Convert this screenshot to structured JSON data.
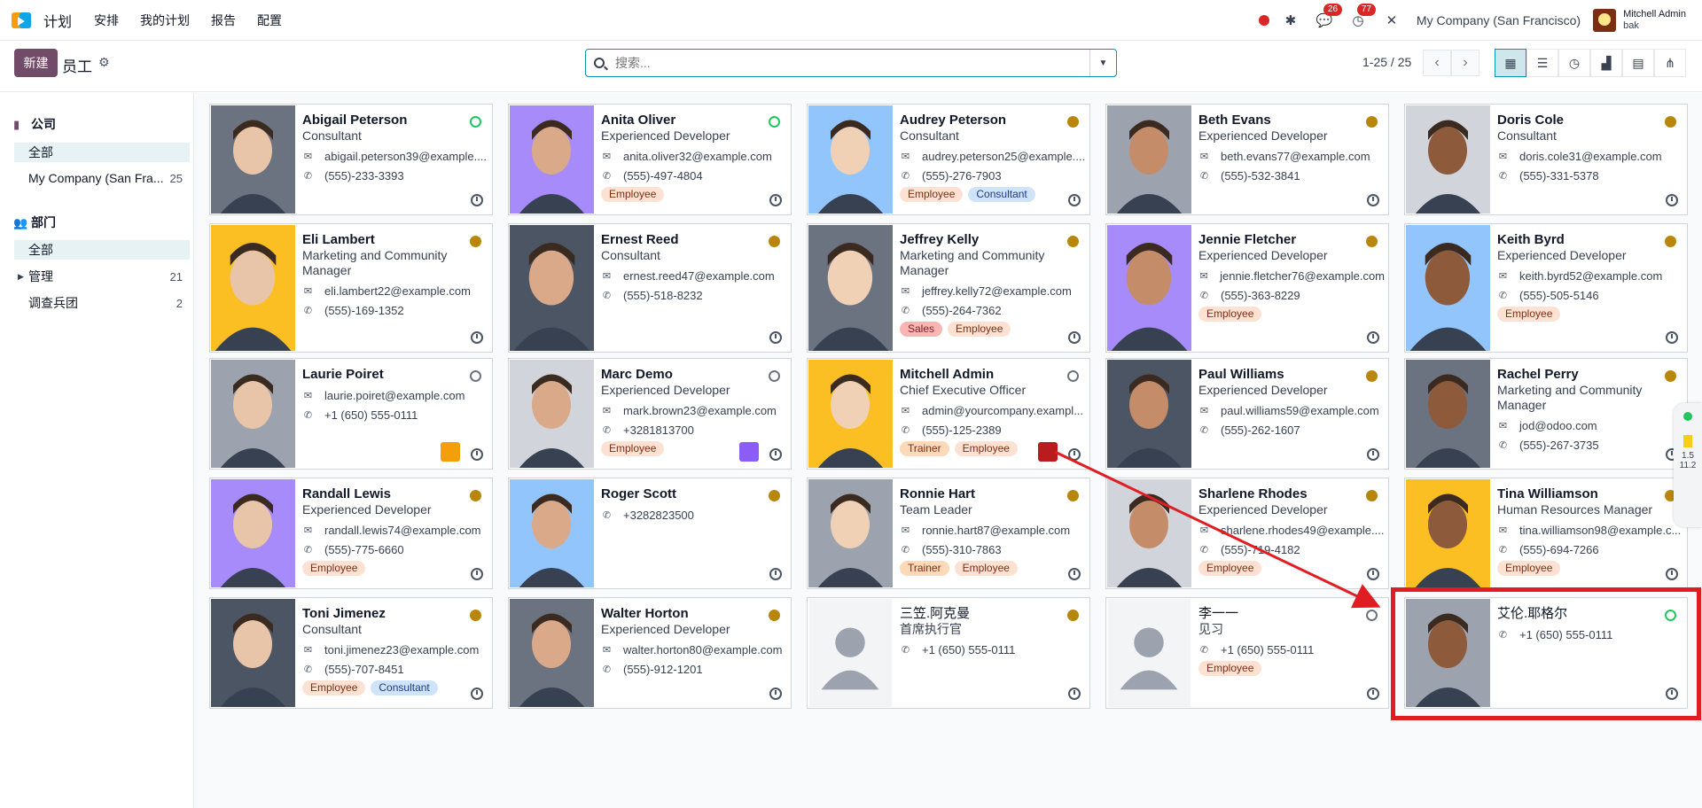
{
  "app": {
    "name": "计划",
    "menu": [
      "安排",
      "我的计划",
      "报告",
      "配置"
    ]
  },
  "nav": {
    "messages_badge": "26",
    "activities_badge": "77",
    "company": "My Company (San Francisco)",
    "user": "Mitchell Admin",
    "db": "bak"
  },
  "control": {
    "new_label": "新建",
    "title": "员工",
    "search_placeholder": "搜索...",
    "pager": "1-25 / 25"
  },
  "sidebar": {
    "company_header": "公司",
    "company_items": [
      {
        "label": "全部",
        "count": ""
      },
      {
        "label": "My Company (San Fra...",
        "count": "25"
      }
    ],
    "dept_header": "部门",
    "dept_items": [
      {
        "label": "全部",
        "count": ""
      },
      {
        "label": "管理",
        "count": "21"
      },
      {
        "label": "调查兵团",
        "count": "2"
      }
    ]
  },
  "cards": [
    {
      "name": "Abigail Peterson",
      "job": "Consultant",
      "email": "abigail.peterson39@example....",
      "phone": "(555)-233-3393",
      "tags": [],
      "status": "online"
    },
    {
      "name": "Anita Oliver",
      "job": "Experienced Developer",
      "email": "anita.oliver32@example.com",
      "phone": "(555)-497-4804",
      "tags": [
        "Employee"
      ],
      "status": "online"
    },
    {
      "name": "Audrey Peterson",
      "job": "Consultant",
      "email": "audrey.peterson25@example....",
      "phone": "(555)-276-7903",
      "tags": [
        "Employee",
        "Consultant"
      ],
      "status": "away"
    },
    {
      "name": "Beth Evans",
      "job": "Experienced Developer",
      "email": "beth.evans77@example.com",
      "phone": "(555)-532-3841",
      "tags": [],
      "status": "away"
    },
    {
      "name": "Doris Cole",
      "job": "Consultant",
      "email": "doris.cole31@example.com",
      "phone": "(555)-331-5378",
      "tags": [],
      "status": "away"
    },
    {
      "name": "Eli Lambert",
      "job": "Marketing and Community Manager",
      "email": "eli.lambert22@example.com",
      "phone": "(555)-169-1352",
      "tags": [],
      "status": "away"
    },
    {
      "name": "Ernest Reed",
      "job": "Consultant",
      "email": "ernest.reed47@example.com",
      "phone": "(555)-518-8232",
      "tags": [],
      "status": "away"
    },
    {
      "name": "Jeffrey Kelly",
      "job": "Marketing and Community Manager",
      "email": "jeffrey.kelly72@example.com",
      "phone": "(555)-264-7362",
      "tags": [
        "Sales",
        "Employee"
      ],
      "status": "away"
    },
    {
      "name": "Jennie Fletcher",
      "job": "Experienced Developer",
      "email": "jennie.fletcher76@example.com",
      "phone": "(555)-363-8229",
      "tags": [
        "Employee"
      ],
      "status": "away"
    },
    {
      "name": "Keith Byrd",
      "job": "Experienced Developer",
      "email": "keith.byrd52@example.com",
      "phone": "(555)-505-5146",
      "tags": [
        "Employee"
      ],
      "status": "away"
    },
    {
      "name": "Laurie Poiret",
      "job": "",
      "email": "laurie.poiret@example.com",
      "phone": "+1 (650) 555-0111",
      "tags": [],
      "status": "off"
    },
    {
      "name": "Marc Demo",
      "job": "Experienced Developer",
      "email": "mark.brown23@example.com",
      "phone": "+3281813700",
      "tags": [
        "Employee"
      ],
      "status": "off"
    },
    {
      "name": "Mitchell Admin",
      "job": "Chief Executive Officer",
      "email": "admin@yourcompany.exampl...",
      "phone": "(555)-125-2389",
      "tags": [
        "Trainer",
        "Employee"
      ],
      "status": "off"
    },
    {
      "name": "Paul Williams",
      "job": "Experienced Developer",
      "email": "paul.williams59@example.com",
      "phone": "(555)-262-1607",
      "tags": [],
      "status": "away"
    },
    {
      "name": "Rachel Perry",
      "job": "Marketing and Community Manager",
      "email": "jod@odoo.com",
      "phone": "(555)-267-3735",
      "tags": [],
      "status": "away"
    },
    {
      "name": "Randall Lewis",
      "job": "Experienced Developer",
      "email": "randall.lewis74@example.com",
      "phone": "(555)-775-6660",
      "tags": [
        "Employee"
      ],
      "status": "away"
    },
    {
      "name": "Roger Scott",
      "job": "",
      "email": "",
      "phone": "+3282823500",
      "tags": [],
      "status": "away"
    },
    {
      "name": "Ronnie Hart",
      "job": "Team Leader",
      "email": "ronnie.hart87@example.com",
      "phone": "(555)-310-7863",
      "tags": [
        "Trainer",
        "Employee"
      ],
      "status": "away"
    },
    {
      "name": "Sharlene Rhodes",
      "job": "Experienced Developer",
      "email": "sharlene.rhodes49@example....",
      "phone": "(555)-719-4182",
      "tags": [
        "Employee"
      ],
      "status": "away"
    },
    {
      "name": "Tina Williamson",
      "job": "Human Resources Manager",
      "email": "tina.williamson98@example.c...",
      "phone": "(555)-694-7266",
      "tags": [
        "Employee"
      ],
      "status": "away"
    },
    {
      "name": "Toni Jimenez",
      "job": "Consultant",
      "email": "toni.jimenez23@example.com",
      "phone": "(555)-707-8451",
      "tags": [
        "Employee",
        "Consultant"
      ],
      "status": "away"
    },
    {
      "name": "Walter Horton",
      "job": "Experienced Developer",
      "email": "walter.horton80@example.com",
      "phone": "(555)-912-1201",
      "tags": [],
      "status": "away"
    },
    {
      "name": "三笠.阿克曼",
      "job": "首席执行官",
      "email": "",
      "phone": "+1 (650) 555-0111",
      "tags": [],
      "status": "away"
    },
    {
      "name": "李一一",
      "job": "见习",
      "email": "",
      "phone": "+1 (650) 555-0111",
      "tags": [
        "Employee"
      ],
      "status": "off"
    },
    {
      "name": "艾伦.耶格尔",
      "job": "",
      "email": "",
      "phone": "+1 (650) 555-0111",
      "tags": [],
      "status": "online"
    }
  ],
  "widget": {
    "up": "1.5",
    "down": "11.2"
  }
}
